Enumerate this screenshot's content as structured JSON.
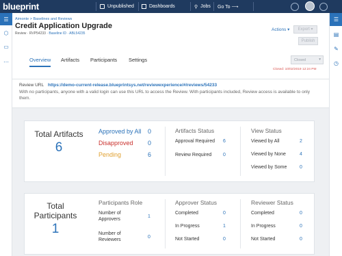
{
  "topbar": {
    "logo": "blueprint",
    "unpublished": "Unpublished",
    "dashboards": "Dashboards",
    "jobs": "Jobs",
    "goto": "Go To ⟶"
  },
  "header": {
    "breadcrumb": "Aimonte > Baselines and Reviews",
    "title": "Credit Application Upgrade",
    "meta_prefix": "Review · RVP54233 · ",
    "meta_baseline": "Baseline ID · ABL54235",
    "actions": "Actions ▾",
    "export": "Export ▾",
    "publish": "Publish",
    "tabs": [
      "Overview",
      "Artifacts",
      "Participants",
      "Settings"
    ],
    "status": "Closed",
    "closed_info": "Closed: 10/02/2019 12:24 PM"
  },
  "url": {
    "label": "Review URL",
    "link": "https://demo-current-release.blueprintsys.net/reviewexperience/#/reviews/54233",
    "note": "With no participants, anyone with a valid login can use this URL to access the Review. With participants included, Review access is available to only them."
  },
  "artifacts_card": {
    "total_label": "Total Artifacts",
    "total": "6",
    "approved_label": "Approved by All",
    "approved": "0",
    "disapproved_label": "Disapproved",
    "disapproved": "0",
    "pending_label": "Pending",
    "pending": "6",
    "status_head": "Artifacts Status",
    "approval_required_label": "Approval Required",
    "approval_required": "6",
    "review_required_label": "Review Required",
    "review_required": "0",
    "view_head": "View Status",
    "viewed_all_label": "Viewed by All",
    "viewed_all": "2",
    "viewed_none_label": "Viewed by None",
    "viewed_none": "4",
    "viewed_some_label": "Viewed by Some",
    "viewed_some": "0"
  },
  "participants_card": {
    "total_label_1": "Total",
    "total_label_2": "Participants",
    "total": "1",
    "role_head": "Participants Role",
    "approvers_label_1": "Number of",
    "approvers_label_2": "Approvers",
    "approvers": "1",
    "reviewers_label_1": "Number of",
    "reviewers_label_2": "Reviewers",
    "reviewers": "0",
    "approver_head": "Approver Status",
    "a_completed_label": "Completed",
    "a_completed": "0",
    "a_inprogress_label": "In Progress",
    "a_inprogress": "1",
    "a_notstarted_label": "Not Started",
    "a_notstarted": "0",
    "reviewer_head": "Reviewer Status",
    "r_completed_label": "Completed",
    "r_completed": "0",
    "r_inprogress_label": "In Progress",
    "r_inprogress": "0",
    "r_notstarted_label": "Not Started",
    "r_notstarted": "0"
  },
  "colors": {
    "brand": "#1f3a5f",
    "accent": "#2b72b9",
    "danger": "#c9302c",
    "warning": "#e0a030"
  }
}
